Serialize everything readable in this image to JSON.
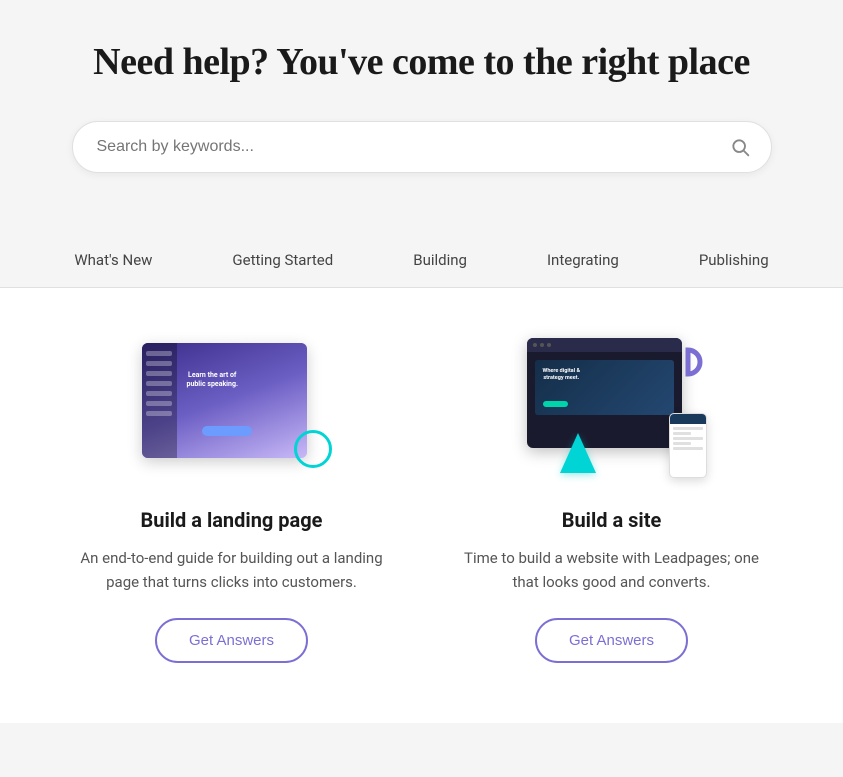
{
  "hero": {
    "title": "Need help? You've come to the right place",
    "search": {
      "placeholder": "Search by keywords..."
    }
  },
  "nav": {
    "items": [
      {
        "id": "whats-new",
        "label": "What's New"
      },
      {
        "id": "getting-started",
        "label": "Getting Started"
      },
      {
        "id": "building",
        "label": "Building"
      },
      {
        "id": "integrating",
        "label": "Integrating"
      },
      {
        "id": "publishing",
        "label": "Publishing"
      }
    ]
  },
  "cards": [
    {
      "id": "landing-page",
      "title": "Build a landing page",
      "description": "An end-to-end guide for building out a landing page that turns clicks into customers.",
      "button_label": "Get Answers"
    },
    {
      "id": "build-site",
      "title": "Build a site",
      "description": "Time to build a website with Leadpages; one that looks good and converts.",
      "button_label": "Get Answers"
    }
  ]
}
